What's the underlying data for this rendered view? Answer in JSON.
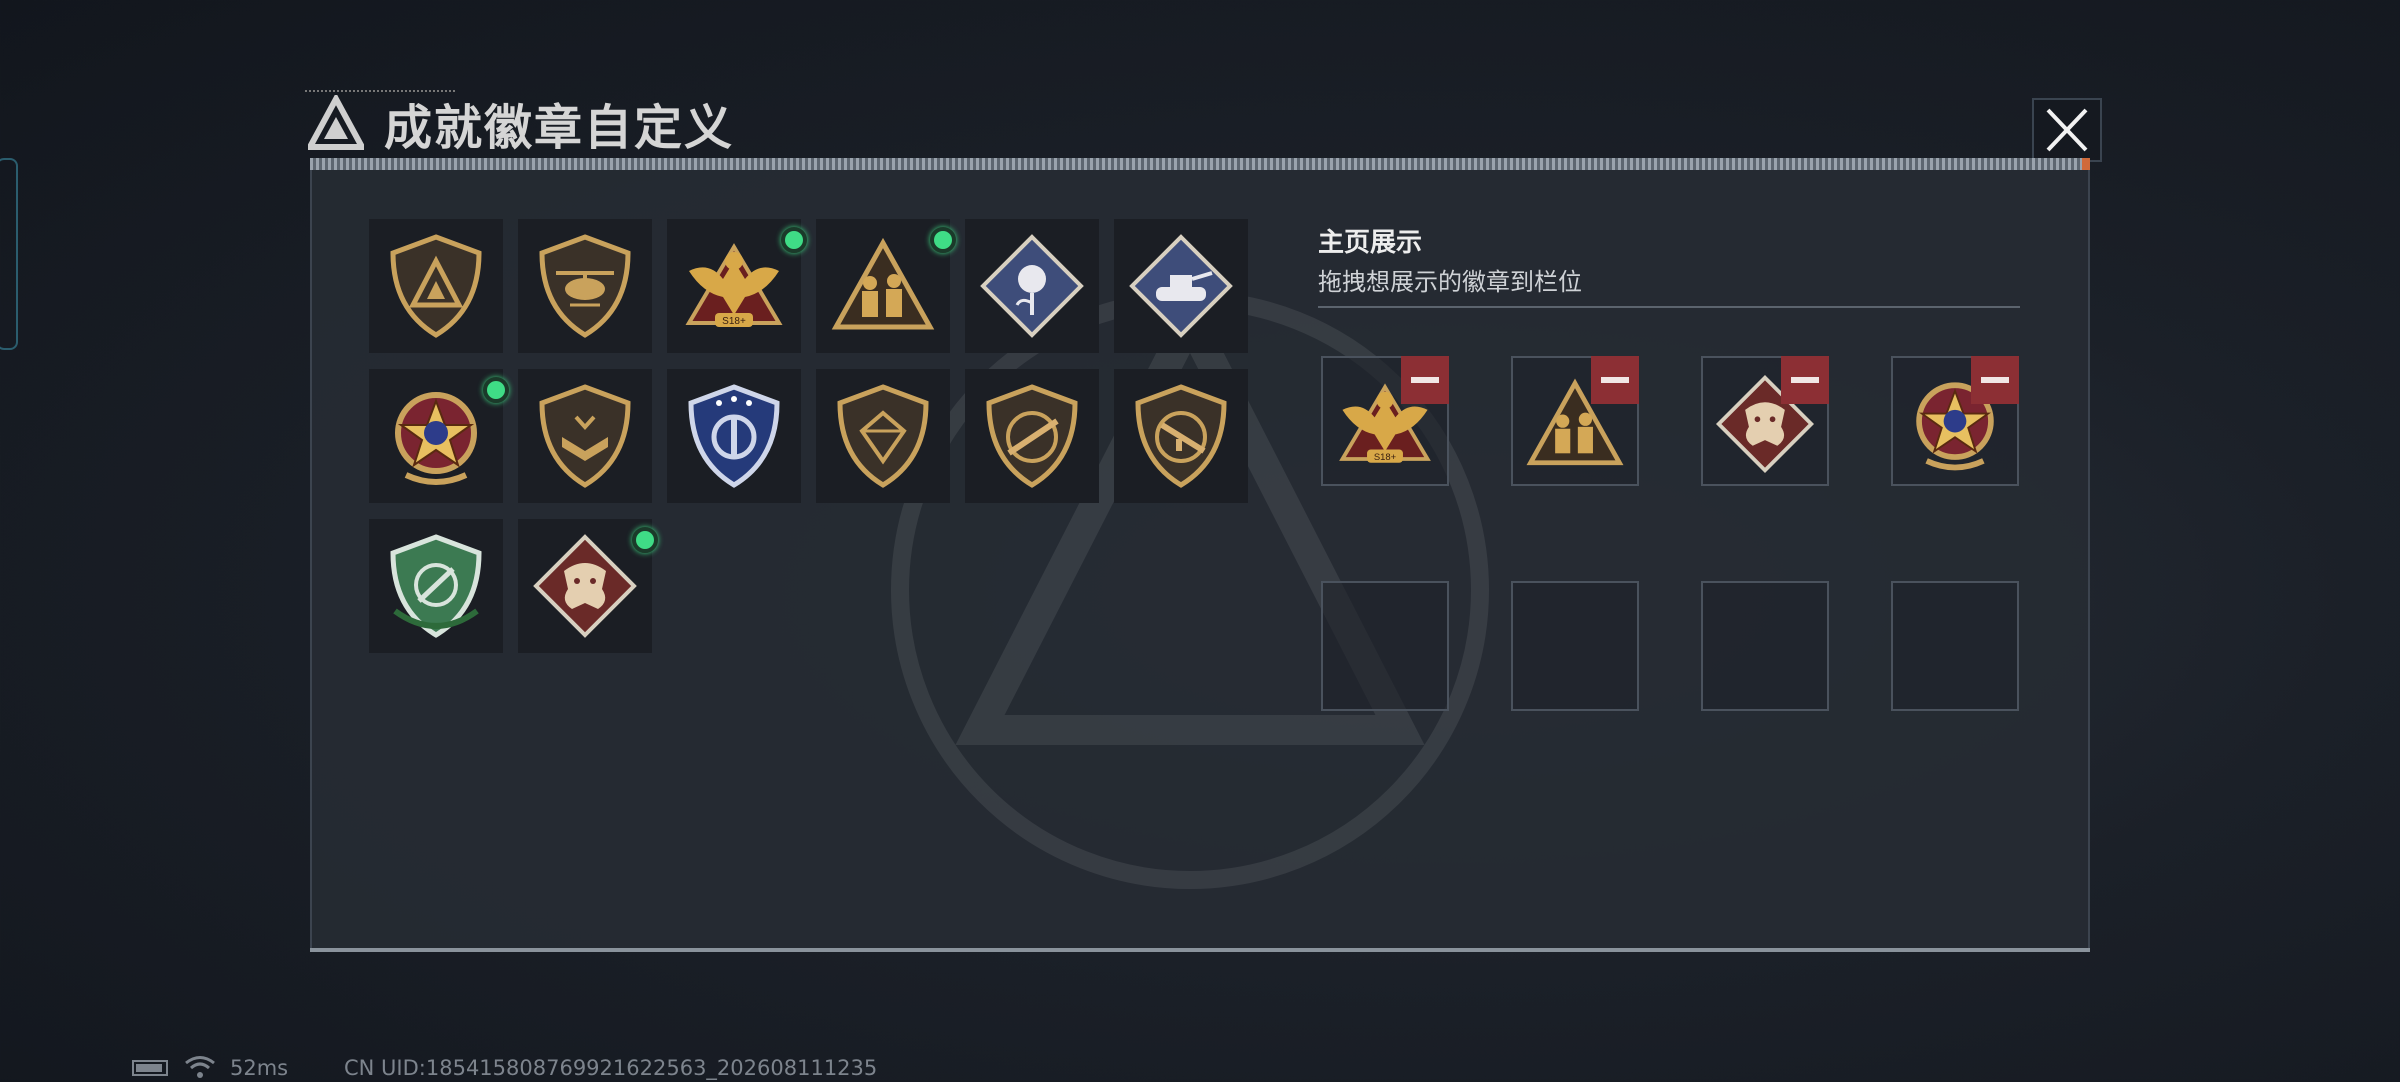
{
  "dialog": {
    "title": "成就徽章自定义",
    "close_icon": "close-icon"
  },
  "badges": [
    {
      "icon": "triangle-shield-badge-icon",
      "new": false
    },
    {
      "icon": "helicopter-badge-icon",
      "new": false
    },
    {
      "icon": "eagle-518-badge-icon",
      "new": true,
      "label": "S18+"
    },
    {
      "icon": "soldiers-triangle-badge-icon",
      "new": true
    },
    {
      "icon": "rose-diamond-badge-icon",
      "new": false
    },
    {
      "icon": "tank-diamond-badge-icon",
      "new": false
    },
    {
      "icon": "star-medal-badge-icon",
      "new": true
    },
    {
      "icon": "chevron-shield-badge-icon",
      "new": false
    },
    {
      "icon": "blue-stars-shield-badge-icon",
      "new": false
    },
    {
      "icon": "gem-shield-badge-icon",
      "new": false
    },
    {
      "icon": "rifle-shield-badge-icon",
      "new": false
    },
    {
      "icon": "smg-shield-badge-icon",
      "new": false
    },
    {
      "icon": "green-target-shield-badge-icon",
      "new": false
    },
    {
      "icon": "dragon-diamond-badge-icon",
      "new": true
    }
  ],
  "showcase": {
    "heading": "主页展示",
    "subtitle": "拖拽想展示的徽章到栏位",
    "slots": [
      {
        "icon": "eagle-518-badge-icon",
        "label": "S18+",
        "filled": true
      },
      {
        "icon": "soldiers-triangle-badge-icon",
        "filled": true
      },
      {
        "icon": "dragon-diamond-badge-icon",
        "filled": true
      },
      {
        "icon": "star-medal-badge-icon",
        "filled": true
      },
      {
        "filled": false
      },
      {
        "filled": false
      },
      {
        "filled": false
      },
      {
        "filled": false
      }
    ],
    "remove_icon": "minus-icon"
  },
  "status_bar": {
    "battery_icon": "battery-icon",
    "wifi_icon": "wifi-icon",
    "ping": "52ms",
    "uid": "CN UID:18541580876992162​2563_202608111235"
  },
  "colors": {
    "gold": "#c9a25c",
    "new_dot": "#3fdc86",
    "remove": "#8c2f34"
  }
}
